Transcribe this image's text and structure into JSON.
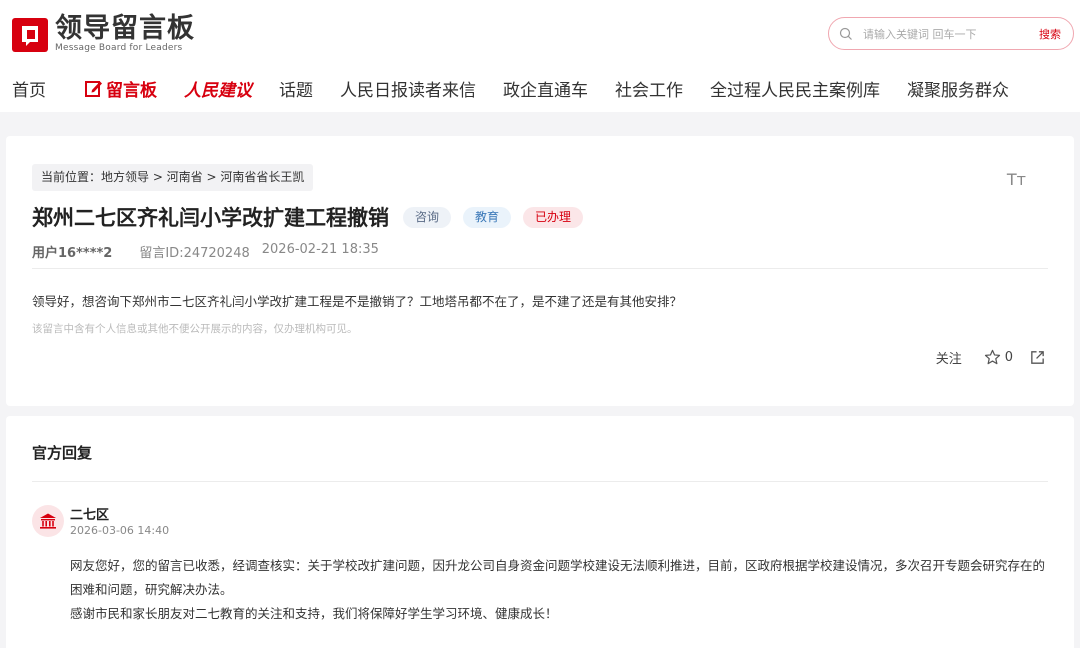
{
  "header": {
    "logo_title": "领导留言板",
    "logo_subtitle": "Message Board for Leaders",
    "search_placeholder": "请输入关键词 回车一下",
    "search_button": "搜索"
  },
  "nav": {
    "items": [
      {
        "label": "首页"
      },
      {
        "label": "留言板"
      },
      {
        "label": "人民建议"
      },
      {
        "label": "话题"
      },
      {
        "label": "人民日报读者来信"
      },
      {
        "label": "政企直通车"
      },
      {
        "label": "社会工作"
      },
      {
        "label": "全过程人民民主案例库"
      },
      {
        "label": "凝聚服务群众"
      }
    ]
  },
  "message": {
    "breadcrumb": "当前位置：地方领导 > 河南省 > 河南省省长王凯",
    "title": "郑州二七区齐礼闫小学改扩建工程撤销",
    "tags": [
      "咨询",
      "教育",
      "已办理"
    ],
    "user": "用户16****2",
    "message_id": "留言ID:24720248",
    "datetime": "2026-02-21 18:35",
    "content": "领导好，想咨询下郑州市二七区齐礼闫小学改扩建工程是不是撤销了？工地塔吊都不在了，是不建了还是有其他安排？",
    "privacy_notice": "该留言中含有个人信息或其他不便公开展示的内容，仅办理机构可见。",
    "follow_label": "关注",
    "star_count": "0",
    "font_size_icon": "Tт"
  },
  "reply": {
    "section_title": "官方回复",
    "department": "二七区",
    "datetime": "2026-03-06 14:40",
    "paragraph1": "网友您好，您的留言已收悉，经调查核实：关于学校改扩建问题，因升龙公司自身资金问题学校建设无法顺利推进，目前，区政府根据学校建设情况，多次召开专题会研究存在的困难和问题，研究解决办法。",
    "paragraph2": "感谢市民和家长朋友对二七教育的关注和支持，我们将保障好学生学习环境、健康成长！"
  },
  "colors": {
    "brand_red": "#d7000f",
    "page_bg": "#f4f4f6"
  }
}
